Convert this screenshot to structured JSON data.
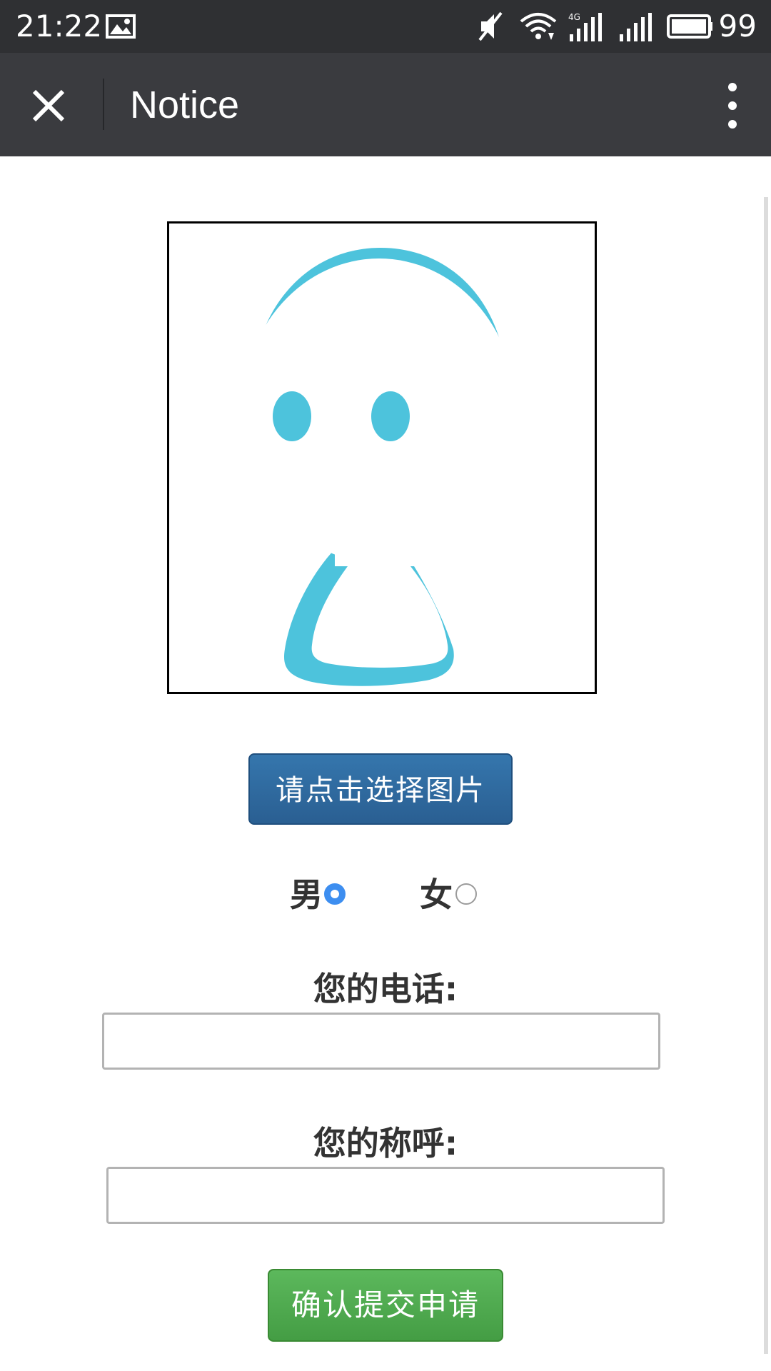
{
  "status_bar": {
    "time": "21:22",
    "battery_percent": "99",
    "icons": [
      "image-icon",
      "mute-icon",
      "wifi-icon",
      "4g-signal-icon",
      "signal-icon",
      "battery-icon"
    ],
    "network_label": "4G"
  },
  "nav_bar": {
    "title": "Notice",
    "close_icon": "close-icon",
    "more_icon": "more-vertical-icon"
  },
  "form": {
    "avatar_icon": "avatar-placeholder-icon",
    "avatar_color": "#4dc3dc",
    "pick_image_button": "请点击选择图片",
    "gender": {
      "male_label": "男",
      "female_label": "女",
      "selected": "男"
    },
    "phone_label": "您的电话:",
    "phone_value": "",
    "name_label": "您的称呼:",
    "name_value": "",
    "submit_button": "确认提交申请"
  },
  "colors": {
    "status_bar_bg": "#2f3033",
    "nav_bar_bg": "#3a3b3f",
    "primary_button": "#2f6aa0",
    "success_button": "#4cae4c",
    "radio_selected": "#3d8ef0"
  }
}
